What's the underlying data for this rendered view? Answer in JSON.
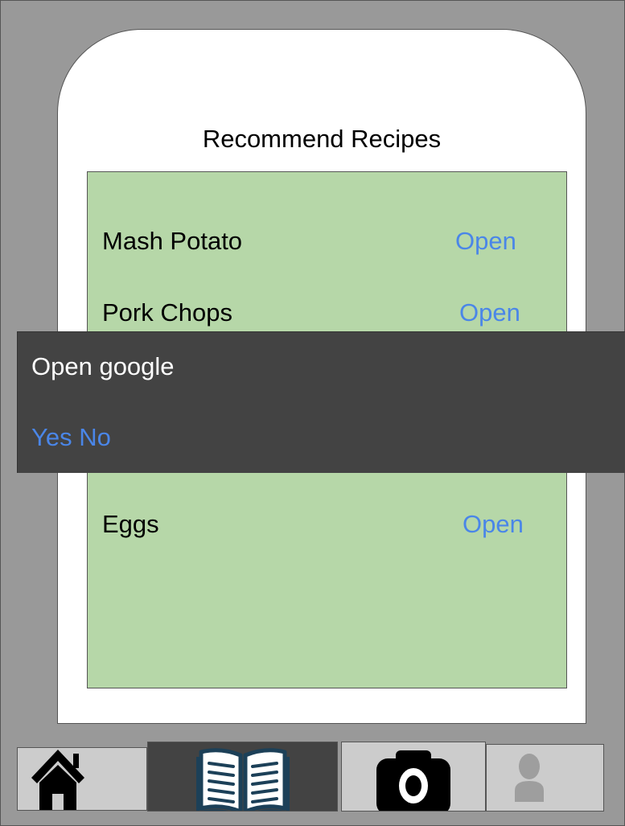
{
  "screen": {
    "title": "Recommend Recipes"
  },
  "recipes": [
    {
      "name": "Mash Potato",
      "action": "Open"
    },
    {
      "name": "Pork Chops",
      "action": "Open"
    },
    {
      "name": "Eggs",
      "action": "Open"
    }
  ],
  "dialog": {
    "title": "Open google",
    "yes_label": "Yes",
    "no_label": "No"
  },
  "tabs": [
    {
      "id": "home",
      "icon": "home-icon"
    },
    {
      "id": "recipes",
      "icon": "book-icon",
      "selected": true
    },
    {
      "id": "camera",
      "icon": "camera-icon"
    },
    {
      "id": "profile",
      "icon": "person-icon"
    }
  ],
  "colors": {
    "background": "#999999",
    "panel": "#b6d7a8",
    "link": "#4a86e8",
    "dialog": "#434343",
    "tab_selected": "#434343",
    "tab": "#cccccc"
  }
}
